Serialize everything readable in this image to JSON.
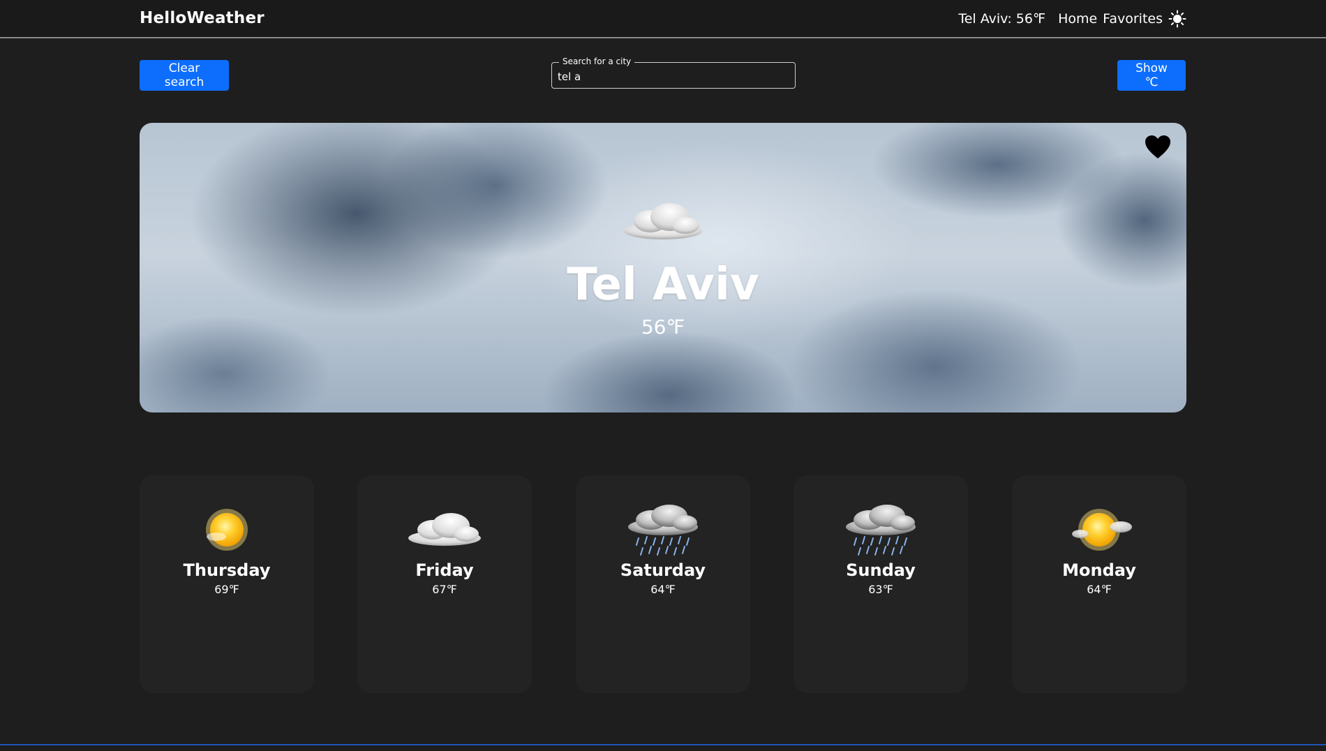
{
  "navbar": {
    "brand": "HelloWeather",
    "current_weather": "Tel Aviv: 56℉",
    "links": [
      "Home",
      "Favorites"
    ],
    "theme_icon": "sun-icon"
  },
  "controls": {
    "clear_label": "Clear search",
    "unit_toggle_label": "Show ℃",
    "search": {
      "label": "Search for a city",
      "value": "tel a"
    }
  },
  "hero": {
    "city": "Tel Aviv",
    "temperature": "56℉",
    "condition_icon": "cloudy-icon",
    "favorite_icon": "heart-icon"
  },
  "forecast": [
    {
      "day": "Thursday",
      "temp": "69℉",
      "icon": "sunny-icon"
    },
    {
      "day": "Friday",
      "temp": "67℉",
      "icon": "cloudy-icon"
    },
    {
      "day": "Saturday",
      "temp": "64℉",
      "icon": "rain-icon"
    },
    {
      "day": "Sunday",
      "temp": "63℉",
      "icon": "rain-icon"
    },
    {
      "day": "Monday",
      "temp": "64℉",
      "icon": "partly-sunny-icon"
    }
  ],
  "colors": {
    "background": "#1e1e1e",
    "accent": "#0d6efd",
    "card": "#232323"
  }
}
